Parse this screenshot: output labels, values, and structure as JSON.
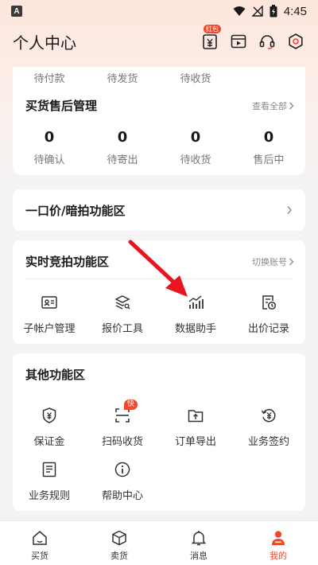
{
  "status_bar": {
    "app_letter": "A",
    "time": "4:45"
  },
  "header": {
    "title": "个人中心",
    "wallet_badge": "红包"
  },
  "orders": {
    "labels": [
      "待付款",
      "待发货",
      "待收货"
    ]
  },
  "aftersale": {
    "title": "买货售后管理",
    "view_all": "查看全部",
    "stats": [
      {
        "count": "0",
        "label": "待确认"
      },
      {
        "count": "0",
        "label": "待寄出"
      },
      {
        "count": "0",
        "label": "待收货"
      },
      {
        "count": "0",
        "label": "售后中"
      }
    ]
  },
  "fixed_price": {
    "title": "一口价/暗拍功能区"
  },
  "live_auction": {
    "title": "实时竞拍功能区",
    "switch_account": "切换账号",
    "items": [
      {
        "label": "子帐户管理",
        "icon": "id-card-icon"
      },
      {
        "label": "报价工具",
        "icon": "layers-search-icon"
      },
      {
        "label": "数据助手",
        "icon": "bar-chart-trend-icon"
      },
      {
        "label": "出价记录",
        "icon": "record-clock-icon"
      }
    ]
  },
  "other": {
    "title": "其他功能区",
    "quick_badge": "快",
    "items": [
      {
        "label": "保证金",
        "icon": "shield-yen-icon"
      },
      {
        "label": "扫码收货",
        "icon": "scan-icon"
      },
      {
        "label": "订单导出",
        "icon": "folder-export-icon"
      },
      {
        "label": "业务签约",
        "icon": "refresh-yen-icon"
      },
      {
        "label": "业务规则",
        "icon": "receipt-icon"
      },
      {
        "label": "帮助中心",
        "icon": "info-icon"
      }
    ]
  },
  "bottom_nav": [
    {
      "label": "买货",
      "icon": "home-icon"
    },
    {
      "label": "卖货",
      "icon": "box-icon"
    },
    {
      "label": "消息",
      "icon": "bell-icon"
    },
    {
      "label": "我的",
      "icon": "person-icon",
      "active": true
    }
  ],
  "colors": {
    "accent": "#f0472d",
    "background": "#f3f3f4",
    "card": "#ffffff"
  }
}
